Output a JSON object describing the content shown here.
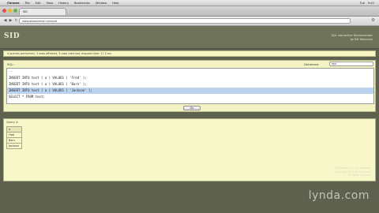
{
  "menubar": {
    "apple": "",
    "items": [
      "Chrome",
      "File",
      "Edit",
      "View",
      "History",
      "Bookmarks",
      "Window",
      "Help"
    ],
    "right_items": [
      "Tue",
      "9:41"
    ]
  },
  "browser": {
    "tab_title": "SID",
    "back": "◀",
    "forward": "▶",
    "reload": "↻",
    "url": "www.billweinman.com/sid",
    "wrench": "⚙"
  },
  "header": {
    "logo": "SID",
    "subtitle": "SQL Interactive Demonstrator",
    "author": "by Bill Weinman"
  },
  "notice": "4 queries performed, 3 rows affected, 3 rows returned, elapsed time: 17.2 ms",
  "sql_panel": {
    "label": "SQL:",
    "database_label": "Database:",
    "database_value": "test",
    "lines": [
      "--",
      "INSERT INTO test ( a ) VALUES ( 'Fred' );",
      "INSERT INTO test ( a ) VALUES ( 'Barn' );",
      "INSERT INTO test ( a ) VALUES ( 'Jackson' );",
      "SELECT * FROM test;"
    ],
    "selected_line": 3,
    "go_label": "Go"
  },
  "results": {
    "title": "Query 4:",
    "column": "a",
    "rows": [
      "Fred",
      "Barn",
      "Jackson"
    ]
  },
  "footer": {
    "line1": "SID version 2.5, Bill Weinman",
    "line2": "Copyright 2011 Bill Weinman",
    "line3": "All rights reserved"
  },
  "watermark": "lynda.com"
}
